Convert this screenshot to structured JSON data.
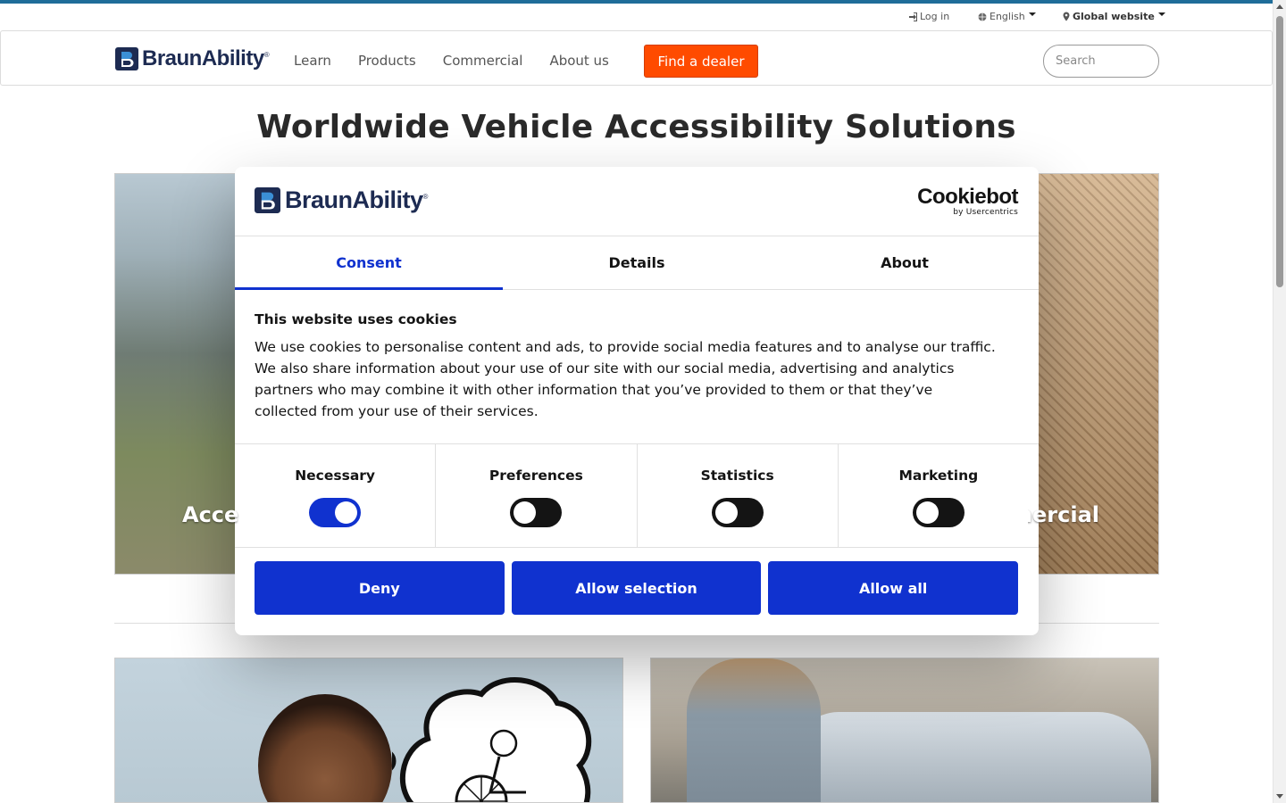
{
  "utility": {
    "login": "Log in",
    "language": "English",
    "region": "Global website"
  },
  "brand": {
    "name": "BraunAbility",
    "trademark": "®"
  },
  "nav": {
    "items": [
      {
        "label": "Learn"
      },
      {
        "label": "Products"
      },
      {
        "label": "Commercial"
      },
      {
        "label": "About us"
      }
    ],
    "dealer_button": "Find a dealer",
    "search_placeholder": "Search"
  },
  "hero": {
    "title": "Worldwide Vehicle Accessibility Solutions",
    "left_tile_caption": "Acce",
    "right_tile_caption": "mercial"
  },
  "cookie_dialog": {
    "provider_name": "Cookiebot",
    "provider_sub": "by Usercentrics",
    "tabs": [
      {
        "label": "Consent",
        "active": true
      },
      {
        "label": "Details",
        "active": false
      },
      {
        "label": "About",
        "active": false
      }
    ],
    "title": "This website uses cookies",
    "text": "We use cookies to personalise content and ads, to provide social media features and to analyse our traffic. We also share information about your use of our site with our social media, advertising and analytics partners who may combine it with other information that you’ve provided to them or that they’ve collected from your use of their services.",
    "toggles": [
      {
        "label": "Necessary",
        "on": true
      },
      {
        "label": "Preferences",
        "on": false
      },
      {
        "label": "Statistics",
        "on": false
      },
      {
        "label": "Marketing",
        "on": false
      }
    ],
    "buttons": {
      "deny": "Deny",
      "allow_selection": "Allow selection",
      "allow_all": "Allow all"
    },
    "accent_color": "#1032cf"
  },
  "colors": {
    "brand_navy": "#1d2b52",
    "cta_orange": "#ff4b00",
    "top_line": "#1f6d99"
  }
}
